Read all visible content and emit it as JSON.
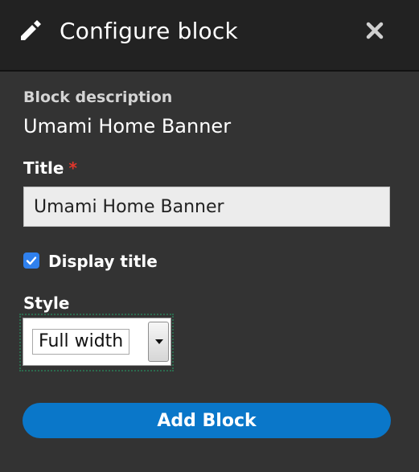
{
  "dialog": {
    "title": "Configure block",
    "pencil_icon": "pencil-icon",
    "close_icon": "close-icon"
  },
  "form": {
    "block_description_label": "Block description",
    "block_description_value": "Umami Home Banner",
    "title_label": "Title",
    "title_required_mark": "*",
    "title_value": "Umami Home Banner",
    "display_title_label": "Display title",
    "display_title_checked": true,
    "style_label": "Style",
    "style_selected": "Full width",
    "submit_label": "Add Block"
  },
  "colors": {
    "header_background": "#222222",
    "panel_background": "#333333",
    "accent": "#0a77c9",
    "checkbox": "#2f80ed",
    "required": "#e0362b"
  }
}
